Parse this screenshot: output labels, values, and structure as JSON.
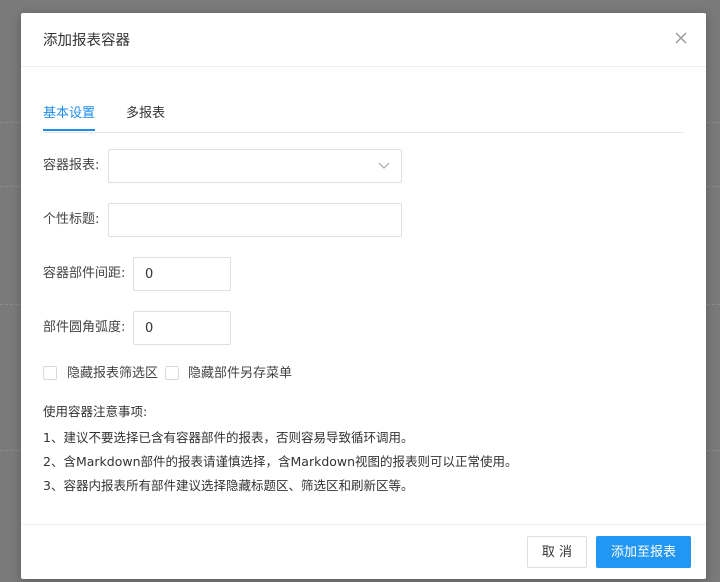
{
  "dialog": {
    "title": "添加报表容器"
  },
  "tabs": [
    {
      "label": "基本设置",
      "active": true
    },
    {
      "label": "多报表",
      "active": false
    }
  ],
  "form": {
    "container_report_label": "容器报表:",
    "container_report_value": "",
    "custom_title_label": "个性标题:",
    "custom_title_value": "",
    "spacing_label": "容器部件间距:",
    "spacing_value": "0",
    "radius_label": "部件圆角弧度:",
    "radius_value": "0",
    "hide_filter_label": "隐藏报表筛选区",
    "hide_filter_checked": false,
    "hide_save_menu_label": "隐藏部件另存菜单",
    "hide_save_menu_checked": false
  },
  "notes": {
    "heading": "使用容器注意事项:",
    "lines": [
      "1、建议不要选择已含有容器部件的报表，否则容易导致循环调用。",
      "2、含Markdown部件的报表请谨慎选择，含Markdown视图的报表则可以正常使用。",
      "3、容器内报表所有部件建议选择隐藏标题区、筛选区和刷新区等。"
    ]
  },
  "footer": {
    "cancel_label": "取 消",
    "confirm_label": "添加至报表"
  },
  "colors": {
    "primary": "#2196f3",
    "tab_active": "#1f8ceb",
    "backdrop": "#7a7a7a"
  },
  "icons": {
    "close": "close-icon",
    "select_arrow": "chevron-down-icon"
  }
}
